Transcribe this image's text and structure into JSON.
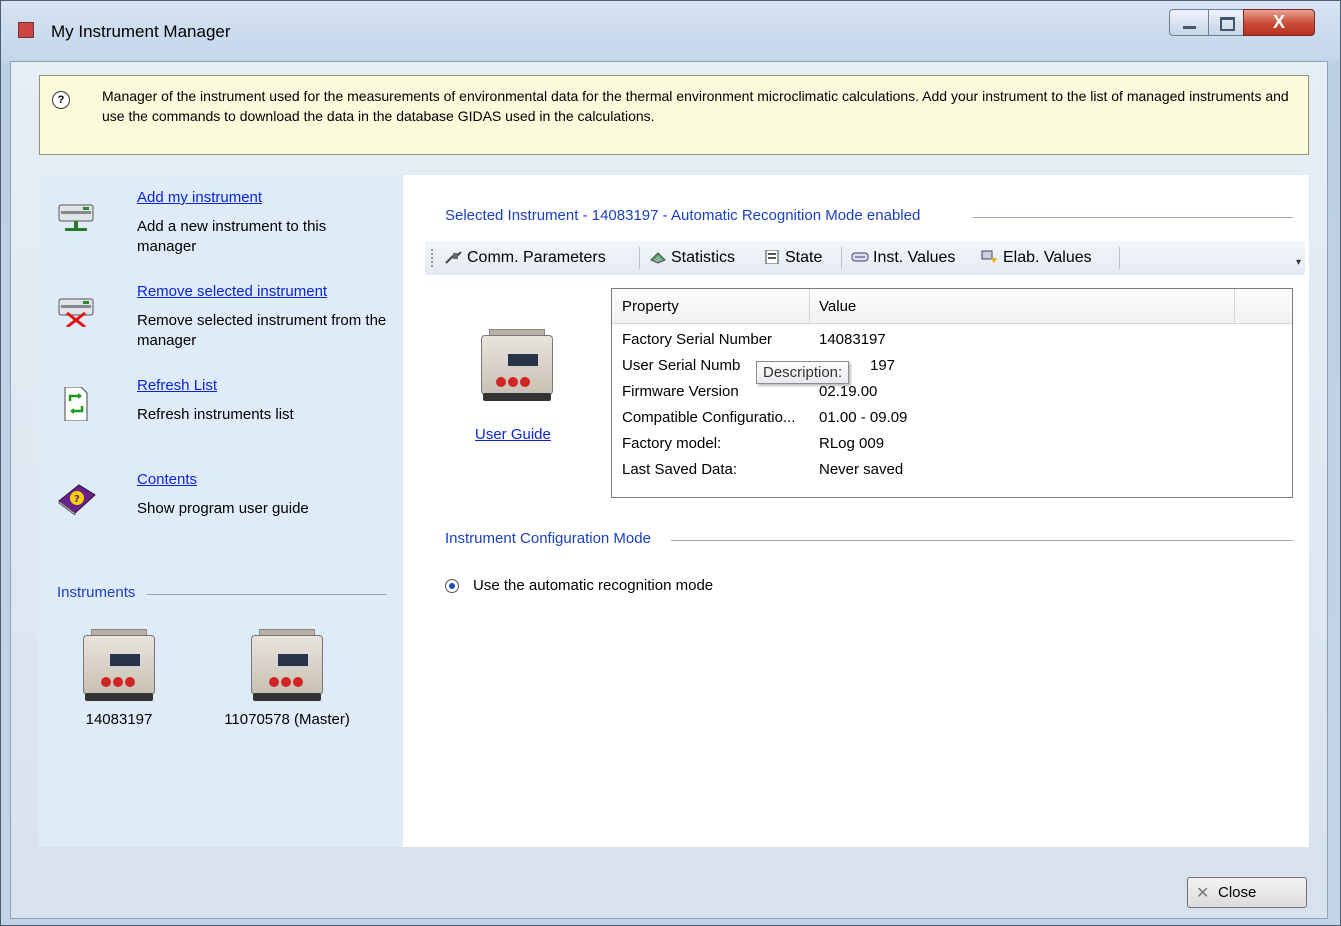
{
  "window": {
    "title": "My Instrument Manager",
    "close_glyph": "X"
  },
  "info": {
    "text": "Manager of the instrument used for the measurements of environmental data for the thermal environment microclimatic calculations. Add your instrument to the list of managed instruments and use the commands to download the data in the database GIDAS used in the calculations."
  },
  "tasks": [
    {
      "link": "Add my instrument",
      "desc": "Add a new instrument to this manager",
      "icon": "add-instrument-icon"
    },
    {
      "link": "Remove selected instrument",
      "desc": "Remove selected instrument from the manager",
      "icon": "remove-instrument-icon"
    },
    {
      "link": "Refresh List",
      "desc": "Refresh instruments list",
      "icon": "refresh-icon"
    },
    {
      "link": "Contents",
      "desc": "Show program user guide",
      "icon": "help-book-icon"
    }
  ],
  "instruments": {
    "heading": "Instruments",
    "items": [
      "14083197",
      "11070578 (Master)"
    ]
  },
  "selected": {
    "heading": "Selected Instrument  - 14083197 - Automatic Recognition Mode enabled",
    "user_guide": "User Guide"
  },
  "toolbar": {
    "comm": "Comm. Parameters",
    "statistics": "Statistics",
    "state": "State",
    "inst_values": "Inst. Values",
    "elab_values": "Elab. Values"
  },
  "grid": {
    "col_property": "Property",
    "col_value": "Value",
    "rows": [
      {
        "property": "Factory Serial Number",
        "value": "14083197"
      },
      {
        "property": "User Serial Numb",
        "value": "197"
      },
      {
        "property": "Firmware Version",
        "value": "02.19.00"
      },
      {
        "property": "Compatible Configuratio...",
        "value": "01.00 - 09.09"
      },
      {
        "property": "Factory model:",
        "value": "RLog 009"
      },
      {
        "property": "Last Saved Data:",
        "value": "Never saved"
      }
    ],
    "tooltip": "Description:"
  },
  "config": {
    "heading": "Instrument Configuration Mode",
    "option": "Use the automatic recognition mode"
  },
  "footer": {
    "close": "Close"
  }
}
